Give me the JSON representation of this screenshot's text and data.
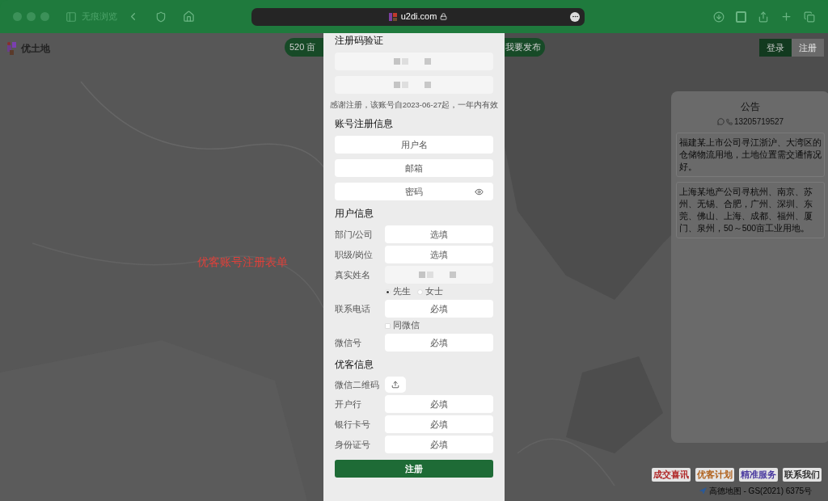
{
  "browser": {
    "tab_group_label": "无痕浏览",
    "url": "u2di.com"
  },
  "site": {
    "logo": "优土地",
    "area_pill": "520 亩",
    "publish_pill": "我要发布",
    "overlay_caption": "优客账号注册表单",
    "auth_tabs": [
      {
        "label": "登录",
        "selected": true
      },
      {
        "label": "注册",
        "selected": false
      }
    ]
  },
  "form": {
    "sections": [
      {
        "title": "注册码验证",
        "rows": [
          {
            "kind": "masked"
          },
          {
            "kind": "masked"
          },
          {
            "kind": "note",
            "text": "感谢注册，该账号自2023-06-27起，一年内有效"
          }
        ]
      },
      {
        "title": "账号注册信息",
        "rows": [
          {
            "kind": "input",
            "placeholder": "用户名"
          },
          {
            "kind": "input",
            "placeholder": "邮箱"
          },
          {
            "kind": "password",
            "placeholder": "密码"
          }
        ]
      },
      {
        "title": "用户信息",
        "rows": [
          {
            "kind": "labeled",
            "label": "部门/公司",
            "placeholder": "选填"
          },
          {
            "kind": "labeled",
            "label": "职级/岗位",
            "placeholder": "选填"
          },
          {
            "kind": "labeled-masked",
            "label": "真实姓名"
          },
          {
            "kind": "radio",
            "options": [
              {
                "label": "先生",
                "selected": true
              },
              {
                "label": "女士",
                "selected": false
              }
            ]
          },
          {
            "kind": "labeled",
            "label": "联系电话",
            "placeholder": "必填"
          },
          {
            "kind": "checkbox",
            "label": "同微信",
            "checked": false
          },
          {
            "kind": "labeled",
            "label": "微信号",
            "placeholder": "必填"
          }
        ]
      },
      {
        "title": "优客信息",
        "rows": [
          {
            "kind": "upload",
            "label": "微信二维码"
          },
          {
            "kind": "labeled",
            "label": "开户行",
            "placeholder": "必填"
          },
          {
            "kind": "labeled",
            "label": "银行卡号",
            "placeholder": "必填"
          },
          {
            "kind": "labeled",
            "label": "身份证号",
            "placeholder": "必填"
          }
        ]
      }
    ],
    "submit": "注册"
  },
  "notice": {
    "title": "公告",
    "phone": "13205719527",
    "items": [
      "福建某上市公司寻江浙沪、大湾区的仓储物流用地，土地位置需交通情况好。",
      "上海某地产公司寻杭州、南京、苏州、无锡、合肥，广州、深圳、东莞、佛山、上海、成都、福州、厦门、泉州，50～500亩工业用地。"
    ]
  },
  "footer": {
    "links": [
      {
        "text": "成交喜讯",
        "color": "#b02828"
      },
      {
        "text": "优客计划",
        "color": "#b0601a"
      },
      {
        "text": "精准服务",
        "color": "#4a3aa0"
      },
      {
        "text": "联系我们",
        "color": "#303030"
      }
    ],
    "attribution": "高德地图 - GS(2021) 6375号"
  }
}
